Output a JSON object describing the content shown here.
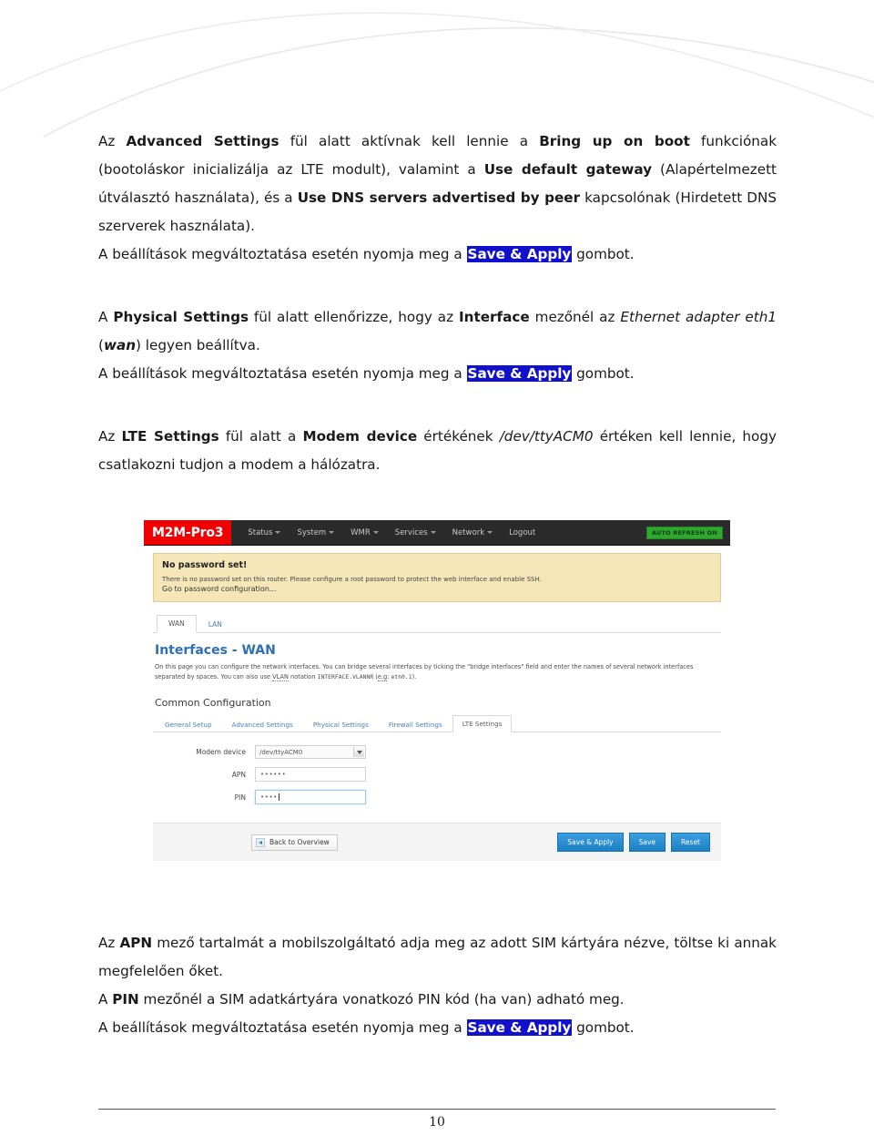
{
  "document": {
    "paragraphs": [
      {
        "id": "p1",
        "runs": [
          {
            "t": "Az ",
            "s": "n"
          },
          {
            "t": "Advanced Settings",
            "s": "b"
          },
          {
            "t": " fül alatt aktívnak kell lennie a ",
            "s": "n"
          },
          {
            "t": "Bring up on boot",
            "s": "b"
          },
          {
            "t": " funkciónak (bootoláskor inicializálja az LTE modult), valamint a ",
            "s": "n"
          },
          {
            "t": "Use default gateway",
            "s": "b"
          },
          {
            "t": " (Alapértelmezett útválasztó használata), és a ",
            "s": "n"
          },
          {
            "t": "Use DNS servers advertised by peer",
            "s": "b"
          },
          {
            "t": " kapcsolónak (Hirdetett DNS szerverek használata).",
            "s": "n"
          }
        ]
      },
      {
        "id": "p2",
        "runs": [
          {
            "t": "A beállítások megváltoztatása esetén nyomja meg a ",
            "s": "n"
          },
          {
            "t": "Save & Apply",
            "s": "hl"
          },
          {
            "t": " gombot.",
            "s": "n"
          }
        ]
      },
      {
        "id": "p3",
        "runs": [
          {
            "t": "A ",
            "s": "n"
          },
          {
            "t": "Physical Settings",
            "s": "b"
          },
          {
            "t": " fül alatt ellenőrizze, hogy az ",
            "s": "n"
          },
          {
            "t": "Interface",
            "s": "b"
          },
          {
            "t": " mezőnél az ",
            "s": "n"
          },
          {
            "t": "Ethernet adapter eth1",
            "s": "i"
          },
          {
            "t": " (",
            "s": "n"
          },
          {
            "t": "wan",
            "s": "bi"
          },
          {
            "t": ") legyen beállítva.",
            "s": "n"
          }
        ]
      },
      {
        "id": "p4",
        "runs": [
          {
            "t": "A beállítások megváltoztatása esetén nyomja meg a ",
            "s": "n"
          },
          {
            "t": "Save & Apply",
            "s": "hl"
          },
          {
            "t": " gombot.",
            "s": "n"
          }
        ]
      },
      {
        "id": "p5",
        "runs": [
          {
            "t": "Az ",
            "s": "n"
          },
          {
            "t": "LTE Settings",
            "s": "b"
          },
          {
            "t": " fül alatt a ",
            "s": "n"
          },
          {
            "t": "Modem device",
            "s": "b"
          },
          {
            "t": " értékének ",
            "s": "n"
          },
          {
            "t": "/dev/ttyACM0",
            "s": "i"
          },
          {
            "t": " értéken kell lennie, hogy csatlakozni tudjon a modem a hálózatra.",
            "s": "n"
          }
        ]
      },
      {
        "id": "p6",
        "runs": [
          {
            "t": "Az ",
            "s": "n"
          },
          {
            "t": "APN",
            "s": "b"
          },
          {
            "t": " mező tartalmát a mobilszolgáltató adja meg az adott SIM kártyára nézve, töltse ki annak megfelelően őket.",
            "s": "n"
          }
        ]
      },
      {
        "id": "p7",
        "runs": [
          {
            "t": "A ",
            "s": "n"
          },
          {
            "t": "PIN",
            "s": "b"
          },
          {
            "t": " mezőnél a SIM adatkártyára vonatkozó PIN kód (ha van) adható meg.",
            "s": "n"
          }
        ]
      },
      {
        "id": "p8",
        "runs": [
          {
            "t": "A beállítások megváltoztatása esetén nyomja meg a ",
            "s": "n"
          },
          {
            "t": "Save & Apply",
            "s": "hl"
          },
          {
            "t": " gombot.",
            "s": "n"
          }
        ]
      }
    ],
    "page_number": "10"
  },
  "screenshot": {
    "nav": {
      "brand": "M2M-Pro3",
      "items": [
        {
          "label": "Status",
          "caret": true
        },
        {
          "label": "System",
          "caret": true
        },
        {
          "label": "WMR",
          "caret": true
        },
        {
          "label": "Services",
          "caret": true
        },
        {
          "label": "Network",
          "caret": true
        },
        {
          "label": "Logout",
          "caret": false
        }
      ],
      "refresh_badge": "AUTO REFRESH ON",
      "brand_color": "#f00000",
      "badge_color": "#2fa82f"
    },
    "warning": {
      "title": "No password set!",
      "body": "There is no password set on this router. Please configure a root password to protect the web interface and enable SSH.",
      "link": "Go to password configuration...",
      "bg_color": "#f5e6b8"
    },
    "interface_tabs": [
      {
        "label": "WAN",
        "active": true
      },
      {
        "label": "LAN",
        "active": false
      }
    ],
    "page": {
      "title": "Interfaces - WAN",
      "title_color": "#2f6fb5",
      "desc_line1": "On this page you can configure the network interfaces. You can bridge several interfaces by ticking the \"bridge interfaces\" field and enter the names of several",
      "desc_line2_a": "network interfaces separated by spaces. You can also use ",
      "desc_vlan": "VLAN",
      "desc_line2_b": " notation ",
      "desc_mono1": "INTERFACE.VLANNR",
      "desc_line2_c": " (",
      "desc_eg": "e.g",
      "desc_line2_d": ": ",
      "desc_mono2": "eth0.1",
      "desc_line2_e": ")."
    },
    "common_config": {
      "heading": "Common Configuration",
      "tabs": [
        {
          "label": "General Setup",
          "active": false
        },
        {
          "label": "Advanced Settings",
          "active": false
        },
        {
          "label": "Physical Settings",
          "active": false
        },
        {
          "label": "Firewall Settings",
          "active": false
        },
        {
          "label": "LTE Settings",
          "active": true
        }
      ]
    },
    "form": {
      "modem_device": {
        "label": "Modem device",
        "value": "/dev/ttyACM0"
      },
      "apn": {
        "label": "APN",
        "value": "••••••"
      },
      "pin": {
        "label": "PIN",
        "value": "••••"
      }
    },
    "buttons": {
      "back": "Back to Overview",
      "save_apply": "Save & Apply",
      "save": "Save",
      "reset": "Reset",
      "accent": "#1a7fc4"
    }
  }
}
